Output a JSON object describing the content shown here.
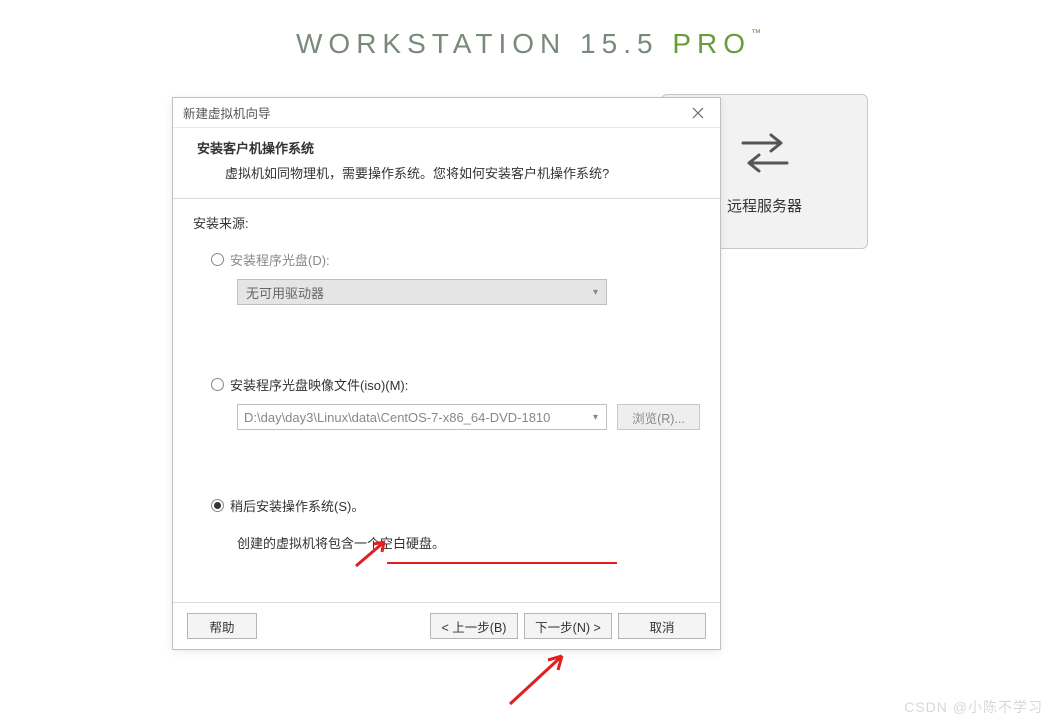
{
  "app": {
    "title_main": "WORKSTATION 15.5 ",
    "title_pro": "PRO",
    "title_tm": "™"
  },
  "remote_card": {
    "label_suffix": "远程服务器"
  },
  "dialog": {
    "title": "新建虚拟机向导",
    "header_title": "安装客户机操作系统",
    "header_desc": "虚拟机如同物理机，需要操作系统。您将如何安装客户机操作系统?",
    "source_label": "安装来源:",
    "option_disc": "安装程序光盘(D):",
    "disc_dropdown": "无可用驱动器",
    "option_iso": "安装程序光盘映像文件(iso)(M):",
    "iso_path": "D:\\day\\day3\\Linux\\data\\CentOS-7-x86_64-DVD-1810",
    "browse_label": "浏览(R)...",
    "option_later": "稍后安装操作系统(S)。",
    "later_note": "创建的虚拟机将包含一个空白硬盘。",
    "btn_help": "帮助",
    "btn_back": "< 上一步(B)",
    "btn_next": "下一步(N) >",
    "btn_cancel": "取消"
  },
  "watermark": "CSDN @小陈不学习"
}
